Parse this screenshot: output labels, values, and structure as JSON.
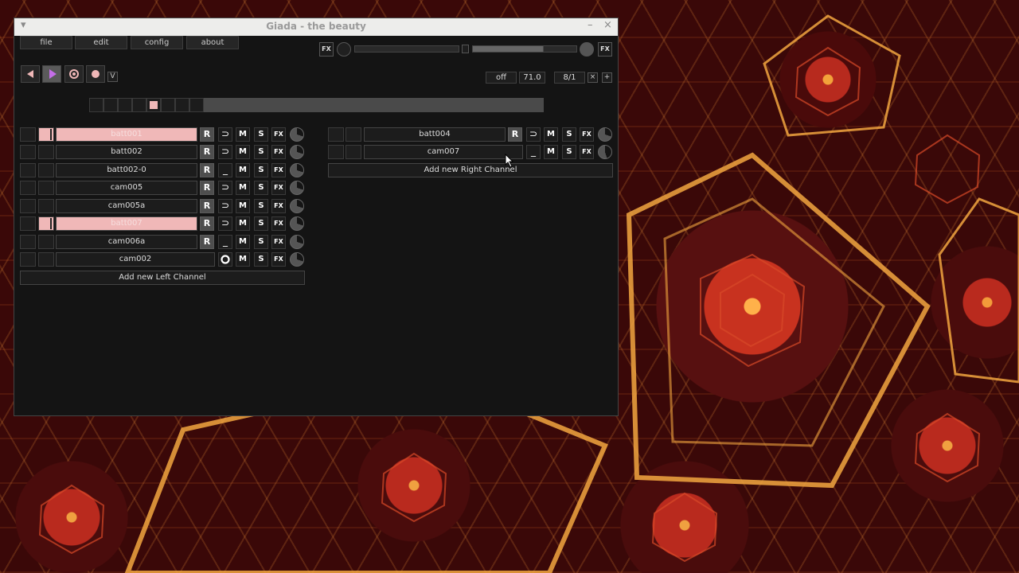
{
  "window": {
    "title": "Giada - the beauty",
    "minimize": "–",
    "close": "×",
    "menu_arrow": "▾"
  },
  "menu": {
    "file": "file",
    "edit": "edit",
    "config": "config",
    "about": "about"
  },
  "master": {
    "fx_in": "FX",
    "fx_out": "FX"
  },
  "transport": {
    "rewind_icon": "rewind-icon",
    "play_icon": "play-icon",
    "record_input_icon": "record-input-icon",
    "record_actions_icon": "record-actions-icon",
    "metronome": "V"
  },
  "timing": {
    "quantize": "off",
    "bpm": "71.0",
    "beats": "8/1",
    "divide": "×",
    "multiply": "+"
  },
  "colors": {
    "active_channel": "#f0b8b8",
    "window_bg": "#141414",
    "button_bg": "#1c1c1c"
  },
  "left_channels": [
    {
      "name": "batt001",
      "active": true,
      "rec": "R",
      "mode": "⊃",
      "mute": "M",
      "solo": "S",
      "fx": "FX"
    },
    {
      "name": "batt002",
      "active": false,
      "rec": "R",
      "mode": "⊃",
      "mute": "M",
      "solo": "S",
      "fx": "FX"
    },
    {
      "name": "batt002-0",
      "active": false,
      "rec": "R",
      "mode": "_",
      "mute": "M",
      "solo": "S",
      "fx": "FX"
    },
    {
      "name": "cam005",
      "active": false,
      "rec": "R",
      "mode": "⊃",
      "mute": "M",
      "solo": "S",
      "fx": "FX"
    },
    {
      "name": "cam005a",
      "active": false,
      "rec": "R",
      "mode": "⊃",
      "mute": "M",
      "solo": "S",
      "fx": "FX"
    },
    {
      "name": "batt007",
      "active": true,
      "rec": "R",
      "mode": "⊃",
      "mute": "M",
      "solo": "S",
      "fx": "FX"
    },
    {
      "name": "cam006a",
      "active": false,
      "rec": "R",
      "mode": "_",
      "mute": "M",
      "solo": "S",
      "fx": "FX"
    },
    {
      "name": "cam002",
      "active": false,
      "rec": "",
      "mode": "O",
      "mute": "M",
      "solo": "S",
      "fx": "FX"
    }
  ],
  "right_channels": [
    {
      "name": "batt004",
      "active": false,
      "rec": "R",
      "mode": "⊃",
      "mute": "M",
      "solo": "S",
      "fx": "FX"
    },
    {
      "name": "cam007",
      "active": false,
      "rec": "",
      "mode": "_",
      "mute": "M",
      "solo": "S",
      "fx": "FX"
    }
  ],
  "add_left": "Add new Left Channel",
  "add_right": "Add new Right Channel"
}
